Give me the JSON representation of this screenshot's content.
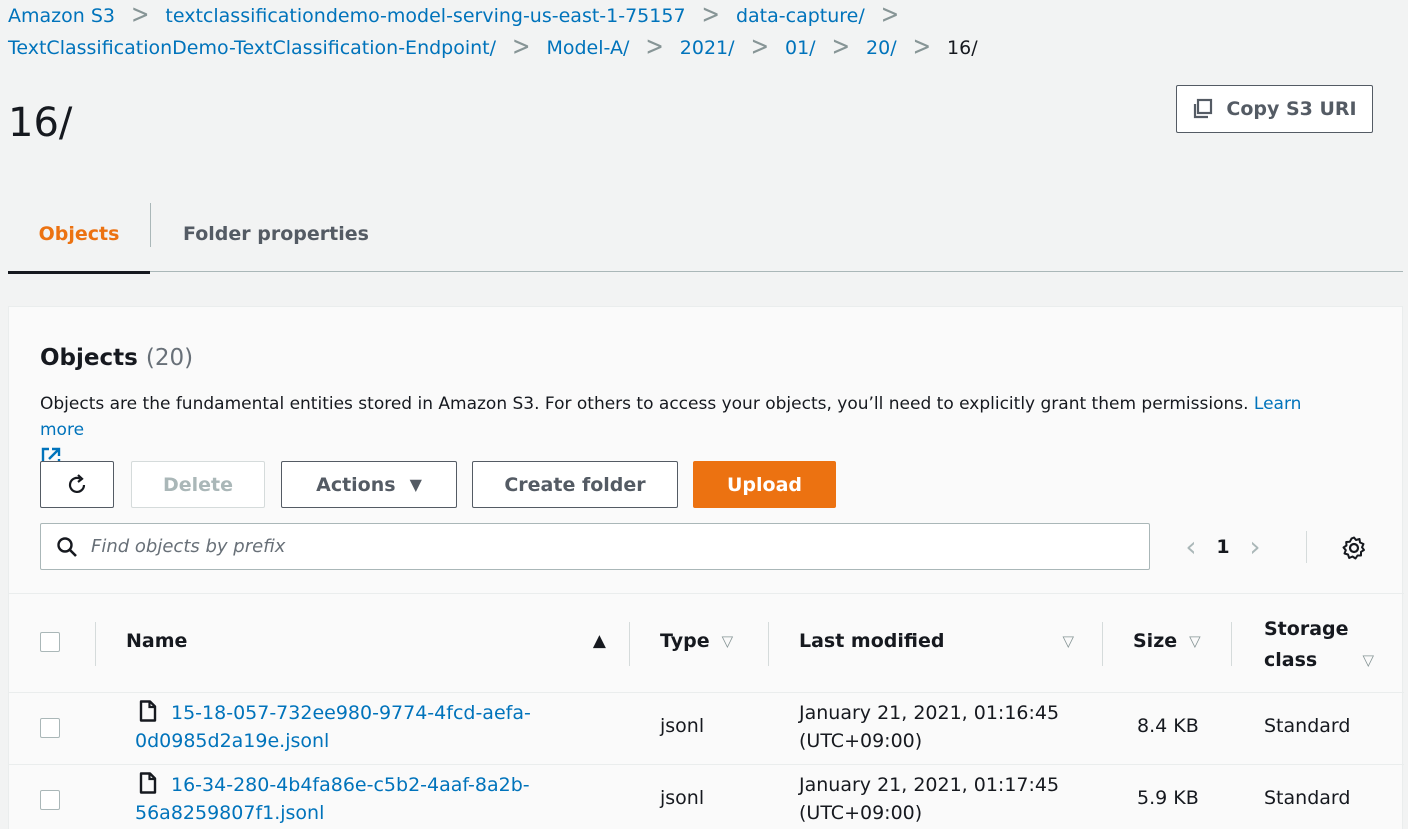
{
  "breadcrumb": {
    "row1": [
      "Amazon S3",
      "textclassificationdemo-model-serving-us-east-1-75157",
      "data-capture/"
    ],
    "row2": [
      "TextClassificationDemo-TextClassification-Endpoint/",
      "Model-A/",
      "2021/",
      "01/",
      "20/"
    ],
    "current": "16/"
  },
  "page": {
    "title": "16/",
    "copy_uri_label": "Copy S3 URI"
  },
  "tabs": [
    {
      "label": "Objects",
      "active": true
    },
    {
      "label": "Folder properties",
      "active": false
    }
  ],
  "objects_panel": {
    "title": "Objects",
    "count": "(20)",
    "description": "Objects are the fundamental entities stored in Amazon S3. For others to access your objects, you’ll need to explicitly grant them permissions.",
    "learn_more": "Learn more",
    "buttons": {
      "delete": "Delete",
      "actions": "Actions",
      "create_folder": "Create folder",
      "upload": "Upload"
    },
    "search_placeholder": "Find objects by prefix",
    "page_number": "1"
  },
  "table": {
    "headers": {
      "name": "Name",
      "type": "Type",
      "last_modified": "Last modified",
      "size": "Size",
      "storage_class_line1": "Storage",
      "storage_class_line2": "class"
    },
    "rows": [
      {
        "name_line1": "15-18-057-732ee980-9774-4fcd-aefa-",
        "name_line2": "0d0985d2a19e.jsonl",
        "type": "jsonl",
        "modified_line1": "January 21, 2021, 01:16:45",
        "modified_line2": "(UTC+09:00)",
        "size": "8.4 KB",
        "storage_class": "Standard"
      },
      {
        "name_line1": "16-34-280-4b4fa86e-c5b2-4aaf-8a2b-",
        "name_line2": "56a8259807f1.jsonl",
        "type": "jsonl",
        "modified_line1": "January 21, 2021, 01:17:45",
        "modified_line2": "(UTC+09:00)",
        "size": "5.9 KB",
        "storage_class": "Standard"
      }
    ]
  },
  "colors": {
    "accent": "#ec7211",
    "link": "#0073bb",
    "text": "#16191f",
    "muted": "#545b64"
  }
}
